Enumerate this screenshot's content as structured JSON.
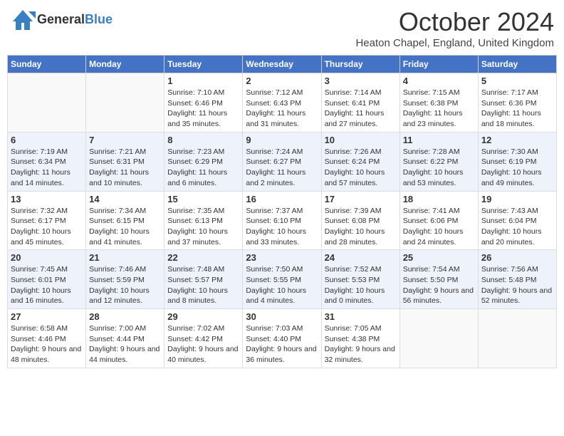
{
  "header": {
    "logo_general": "General",
    "logo_blue": "Blue",
    "month_title": "October 2024",
    "location": "Heaton Chapel, England, United Kingdom"
  },
  "weekdays": [
    "Sunday",
    "Monday",
    "Tuesday",
    "Wednesday",
    "Thursday",
    "Friday",
    "Saturday"
  ],
  "weeks": [
    [
      {
        "day": "",
        "sunrise": "",
        "sunset": "",
        "daylight": ""
      },
      {
        "day": "",
        "sunrise": "",
        "sunset": "",
        "daylight": ""
      },
      {
        "day": "1",
        "sunrise": "Sunrise: 7:10 AM",
        "sunset": "Sunset: 6:46 PM",
        "daylight": "Daylight: 11 hours and 35 minutes."
      },
      {
        "day": "2",
        "sunrise": "Sunrise: 7:12 AM",
        "sunset": "Sunset: 6:43 PM",
        "daylight": "Daylight: 11 hours and 31 minutes."
      },
      {
        "day": "3",
        "sunrise": "Sunrise: 7:14 AM",
        "sunset": "Sunset: 6:41 PM",
        "daylight": "Daylight: 11 hours and 27 minutes."
      },
      {
        "day": "4",
        "sunrise": "Sunrise: 7:15 AM",
        "sunset": "Sunset: 6:38 PM",
        "daylight": "Daylight: 11 hours and 23 minutes."
      },
      {
        "day": "5",
        "sunrise": "Sunrise: 7:17 AM",
        "sunset": "Sunset: 6:36 PM",
        "daylight": "Daylight: 11 hours and 18 minutes."
      }
    ],
    [
      {
        "day": "6",
        "sunrise": "Sunrise: 7:19 AM",
        "sunset": "Sunset: 6:34 PM",
        "daylight": "Daylight: 11 hours and 14 minutes."
      },
      {
        "day": "7",
        "sunrise": "Sunrise: 7:21 AM",
        "sunset": "Sunset: 6:31 PM",
        "daylight": "Daylight: 11 hours and 10 minutes."
      },
      {
        "day": "8",
        "sunrise": "Sunrise: 7:23 AM",
        "sunset": "Sunset: 6:29 PM",
        "daylight": "Daylight: 11 hours and 6 minutes."
      },
      {
        "day": "9",
        "sunrise": "Sunrise: 7:24 AM",
        "sunset": "Sunset: 6:27 PM",
        "daylight": "Daylight: 11 hours and 2 minutes."
      },
      {
        "day": "10",
        "sunrise": "Sunrise: 7:26 AM",
        "sunset": "Sunset: 6:24 PM",
        "daylight": "Daylight: 10 hours and 57 minutes."
      },
      {
        "day": "11",
        "sunrise": "Sunrise: 7:28 AM",
        "sunset": "Sunset: 6:22 PM",
        "daylight": "Daylight: 10 hours and 53 minutes."
      },
      {
        "day": "12",
        "sunrise": "Sunrise: 7:30 AM",
        "sunset": "Sunset: 6:19 PM",
        "daylight": "Daylight: 10 hours and 49 minutes."
      }
    ],
    [
      {
        "day": "13",
        "sunrise": "Sunrise: 7:32 AM",
        "sunset": "Sunset: 6:17 PM",
        "daylight": "Daylight: 10 hours and 45 minutes."
      },
      {
        "day": "14",
        "sunrise": "Sunrise: 7:34 AM",
        "sunset": "Sunset: 6:15 PM",
        "daylight": "Daylight: 10 hours and 41 minutes."
      },
      {
        "day": "15",
        "sunrise": "Sunrise: 7:35 AM",
        "sunset": "Sunset: 6:13 PM",
        "daylight": "Daylight: 10 hours and 37 minutes."
      },
      {
        "day": "16",
        "sunrise": "Sunrise: 7:37 AM",
        "sunset": "Sunset: 6:10 PM",
        "daylight": "Daylight: 10 hours and 33 minutes."
      },
      {
        "day": "17",
        "sunrise": "Sunrise: 7:39 AM",
        "sunset": "Sunset: 6:08 PM",
        "daylight": "Daylight: 10 hours and 28 minutes."
      },
      {
        "day": "18",
        "sunrise": "Sunrise: 7:41 AM",
        "sunset": "Sunset: 6:06 PM",
        "daylight": "Daylight: 10 hours and 24 minutes."
      },
      {
        "day": "19",
        "sunrise": "Sunrise: 7:43 AM",
        "sunset": "Sunset: 6:04 PM",
        "daylight": "Daylight: 10 hours and 20 minutes."
      }
    ],
    [
      {
        "day": "20",
        "sunrise": "Sunrise: 7:45 AM",
        "sunset": "Sunset: 6:01 PM",
        "daylight": "Daylight: 10 hours and 16 minutes."
      },
      {
        "day": "21",
        "sunrise": "Sunrise: 7:46 AM",
        "sunset": "Sunset: 5:59 PM",
        "daylight": "Daylight: 10 hours and 12 minutes."
      },
      {
        "day": "22",
        "sunrise": "Sunrise: 7:48 AM",
        "sunset": "Sunset: 5:57 PM",
        "daylight": "Daylight: 10 hours and 8 minutes."
      },
      {
        "day": "23",
        "sunrise": "Sunrise: 7:50 AM",
        "sunset": "Sunset: 5:55 PM",
        "daylight": "Daylight: 10 hours and 4 minutes."
      },
      {
        "day": "24",
        "sunrise": "Sunrise: 7:52 AM",
        "sunset": "Sunset: 5:53 PM",
        "daylight": "Daylight: 10 hours and 0 minutes."
      },
      {
        "day": "25",
        "sunrise": "Sunrise: 7:54 AM",
        "sunset": "Sunset: 5:50 PM",
        "daylight": "Daylight: 9 hours and 56 minutes."
      },
      {
        "day": "26",
        "sunrise": "Sunrise: 7:56 AM",
        "sunset": "Sunset: 5:48 PM",
        "daylight": "Daylight: 9 hours and 52 minutes."
      }
    ],
    [
      {
        "day": "27",
        "sunrise": "Sunrise: 6:58 AM",
        "sunset": "Sunset: 4:46 PM",
        "daylight": "Daylight: 9 hours and 48 minutes."
      },
      {
        "day": "28",
        "sunrise": "Sunrise: 7:00 AM",
        "sunset": "Sunset: 4:44 PM",
        "daylight": "Daylight: 9 hours and 44 minutes."
      },
      {
        "day": "29",
        "sunrise": "Sunrise: 7:02 AM",
        "sunset": "Sunset: 4:42 PM",
        "daylight": "Daylight: 9 hours and 40 minutes."
      },
      {
        "day": "30",
        "sunrise": "Sunrise: 7:03 AM",
        "sunset": "Sunset: 4:40 PM",
        "daylight": "Daylight: 9 hours and 36 minutes."
      },
      {
        "day": "31",
        "sunrise": "Sunrise: 7:05 AM",
        "sunset": "Sunset: 4:38 PM",
        "daylight": "Daylight: 9 hours and 32 minutes."
      },
      {
        "day": "",
        "sunrise": "",
        "sunset": "",
        "daylight": ""
      },
      {
        "day": "",
        "sunrise": "",
        "sunset": "",
        "daylight": ""
      }
    ]
  ]
}
